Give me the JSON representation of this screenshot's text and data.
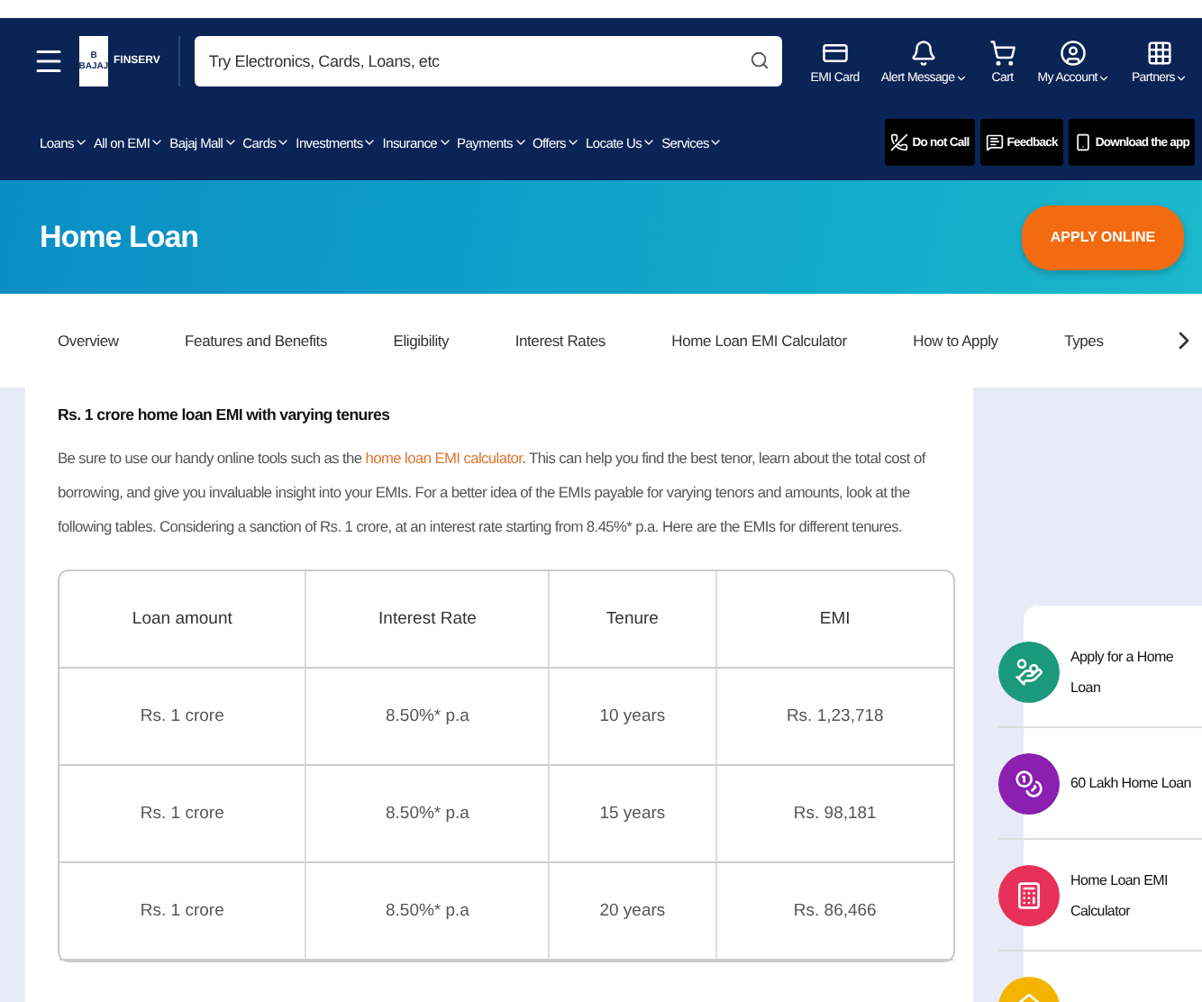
{
  "header": {
    "brand": "FINSERV",
    "logo_letter": "B",
    "logo_caption": "BAJAJ",
    "search": {
      "placeholder": "Try Electronics, Cards, Loans, etc"
    },
    "actions": [
      {
        "kind": "card",
        "label": "EMI Card",
        "dropdown": false
      },
      {
        "kind": "bell",
        "label": "Alert Message",
        "dropdown": true
      },
      {
        "kind": "cart",
        "label": "Cart",
        "dropdown": false
      },
      {
        "kind": "account",
        "label": "My Account",
        "dropdown": true
      },
      {
        "kind": "grid",
        "label": "Partners",
        "dropdown": true
      }
    ]
  },
  "nav": {
    "items": [
      "Loans",
      "All on EMI",
      "Bajaj Mall",
      "Cards",
      "Investments",
      "Insurance",
      "Payments",
      "Offers",
      "Locate Us",
      "Services"
    ],
    "buttons": [
      {
        "kind": "phone-off",
        "label": "Do not Call"
      },
      {
        "kind": "feedback",
        "label": "Feedback"
      },
      {
        "kind": "mobile",
        "label": "Download the app"
      }
    ]
  },
  "banner": {
    "title": "Home Loan",
    "button": "APPLY ONLINE"
  },
  "tabs": [
    "Overview",
    "Features and Benefits",
    "Eligibility",
    "Interest Rates",
    "Home Loan EMI Calculator",
    "How to Apply",
    "Types"
  ],
  "article": {
    "heading": "Rs. 1 crore home loan EMI with varying tenures",
    "paragraph": [
      "Be sure to use our handy online tools such as the ",
      "home loan EMI calculator",
      ". This can help you find the best tenor, learn about the total cost of borrowing, and give you invaluable insight into your EMIs. For a better idea of the EMIs payable for varying tenors and amounts, look at the following tables. Considering a sanction of Rs. 1 crore, at an interest rate starting from 8.45%* p.a. Here are the EMIs for different tenures."
    ],
    "table": {
      "columns": [
        "Loan amount",
        "Interest Rate",
        "Tenure",
        "EMI"
      ],
      "rows": [
        [
          "Rs. 1 crore",
          "8.50%* p.a",
          "10 years",
          "Rs. 1,23,718"
        ],
        [
          "Rs. 1 crore",
          "8.50%* p.a",
          "15 years",
          "Rs. 98,181"
        ],
        [
          "Rs. 1 crore",
          "8.50%* p.a",
          "20 years",
          "Rs. 86,466"
        ]
      ]
    }
  },
  "sidebar": {
    "items": [
      {
        "label": "Apply for a Home Loan",
        "color": "#1a9a7a"
      },
      {
        "label": "60 Lakh Home Loan",
        "color": "#8a1fb0"
      },
      {
        "label": "Home Loan EMI Calculator",
        "color": "#e8315a"
      },
      {
        "color": "#f5b400"
      }
    ]
  }
}
